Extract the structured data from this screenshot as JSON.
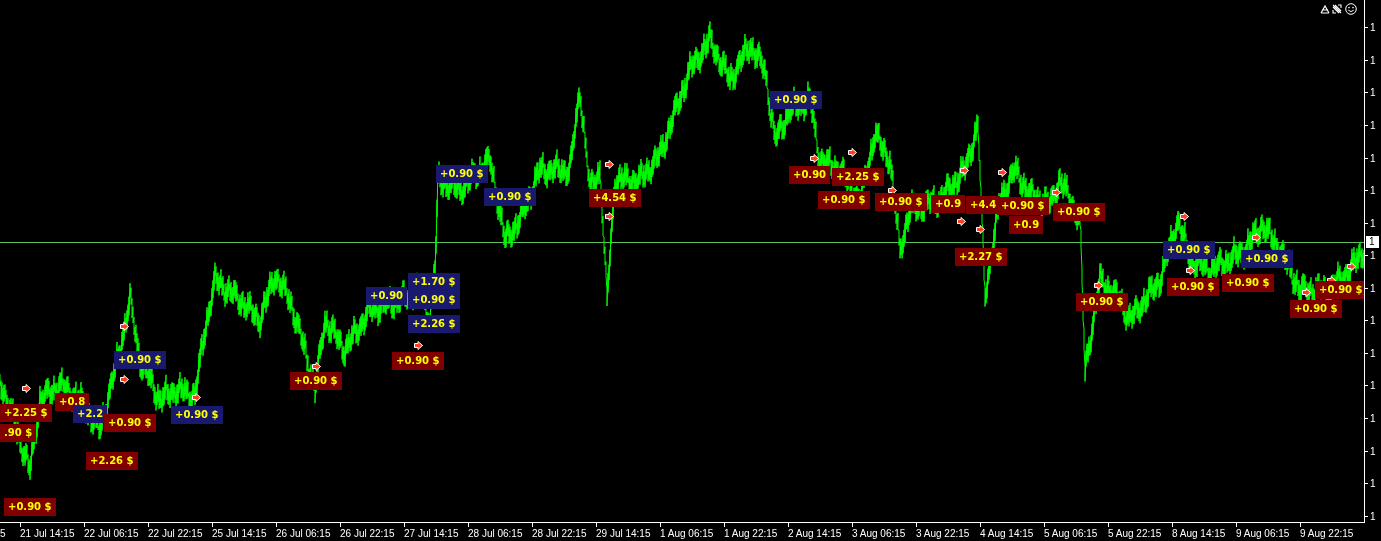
{
  "chart": {
    "trade_labels": [
      {
        "text": "+0.90 $",
        "color": "#191970"
      },
      {
        "text": "+0.90 $",
        "color": "#191970"
      },
      {
        "text": "+0.90",
        "color": "#800000"
      },
      {
        "text": "+2.25 $",
        "color": "#800000"
      },
      {
        "text": "+0.90 $",
        "color": "#191970"
      },
      {
        "text": "+4.54 $",
        "color": "#800000"
      },
      {
        "text": "+0.90 $",
        "color": "#800000"
      },
      {
        "text": "+0.90 $",
        "color": "#800000"
      },
      {
        "text": "+0.9",
        "color": "#800000"
      },
      {
        "text": "+4.4",
        "color": "#800000"
      },
      {
        "text": "+0.90 $",
        "color": "#800000"
      },
      {
        "text": "+0.90 $",
        "color": "#800000"
      },
      {
        "text": "+0.9",
        "color": "#800000"
      },
      {
        "text": "+0.90 $",
        "color": "#191970"
      },
      {
        "text": "+2.27 $",
        "color": "#800000"
      },
      {
        "text": "+0.90 $",
        "color": "#191970"
      },
      {
        "text": "+1.70 $",
        "color": "#191970"
      },
      {
        "text": "+0.90 $",
        "color": "#800000"
      },
      {
        "text": "+0.90 $",
        "color": "#800000"
      },
      {
        "text": "+0.90 $",
        "color": "#800000"
      },
      {
        "text": "+0.90",
        "color": "#191970"
      },
      {
        "text": "+0.90 $",
        "color": "#191970"
      },
      {
        "text": "+0.90 $",
        "color": "#800000"
      },
      {
        "text": "+0.90 $",
        "color": "#800000"
      },
      {
        "text": "+2.26 $",
        "color": "#191970"
      },
      {
        "text": "+0.90 $",
        "color": "#191970"
      },
      {
        "text": "+0.90 $",
        "color": "#800000"
      },
      {
        "text": "+0.90 $",
        "color": "#800000"
      },
      {
        "text": "+0.8",
        "color": "#800000"
      },
      {
        "text": "+2.25 $",
        "color": "#800000"
      },
      {
        "text": "+2.2",
        "color": "#191970"
      },
      {
        "text": "+0.90 $",
        "color": "#191970"
      },
      {
        "text": "+0.90 $",
        "color": "#800000"
      },
      {
        "text": ".90 $",
        "color": "#800000"
      },
      {
        "text": "+2.26 $",
        "color": "#800000"
      },
      {
        "text": "+0.90 $",
        "color": "#800000"
      }
    ],
    "price_axis": {
      "labels": [
        "1",
        "1",
        "1",
        "1",
        "1",
        "1",
        "1",
        "1",
        "1",
        "1",
        "1",
        "1",
        "1",
        "1",
        "1",
        "1"
      ],
      "current_price": "1"
    },
    "time_axis": {
      "labels": [
        "5",
        "21 Jul 14:15",
        "22 Jul 06:15",
        "22 Jul 22:15",
        "25 Jul 14:15",
        "26 Jul 06:15",
        "26 Jul 22:15",
        "27 Jul 14:15",
        "28 Jul 06:15",
        "28 Jul 22:15",
        "29 Jul 14:15",
        "1 Aug 06:15",
        "1 Aug 22:15",
        "2 Aug 14:15",
        "3 Aug 06:15",
        "3 Aug 22:15",
        "4 Aug 14:15",
        "5 Aug 06:15",
        "5 Aug 22:15",
        "8 Aug 14:15",
        "9 Aug 06:15",
        "9 Aug 22:15"
      ]
    }
  }
}
